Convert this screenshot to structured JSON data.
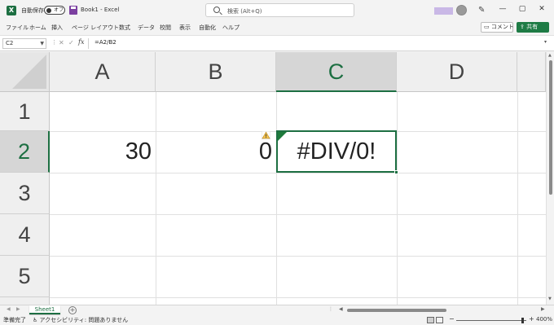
{
  "titlebar": {
    "app_icon_letter": "X",
    "autosave_label": "自動保存",
    "autosave_state": "オフ",
    "filename": "Book1 - Excel",
    "search_placeholder": "検索 (Alt+Q)",
    "window_controls": [
      "—",
      "▢",
      "✕"
    ]
  },
  "menu": {
    "items": [
      "ファイル",
      "ホーム",
      "挿入",
      "ページ レイアウト",
      "数式",
      "データ",
      "校閲",
      "表示",
      "自動化",
      "ヘルプ"
    ],
    "comment_label": "コメント",
    "share_label": "共有"
  },
  "formula_bar": {
    "name_box": "C2",
    "fx_label": "fx",
    "formula": "=A2/B2"
  },
  "grid": {
    "columns": [
      "A",
      "B",
      "C",
      "D"
    ],
    "rows": [
      "1",
      "2",
      "3",
      "4",
      "5"
    ],
    "selected_cell": "C2",
    "cells": {
      "A2": "30",
      "B2": "0",
      "C2": "#DIV/0!"
    }
  },
  "sheets": {
    "tabs": [
      "Sheet1"
    ],
    "add_label": "+"
  },
  "statusbar": {
    "ready": "準備完了",
    "accessibility": "アクセシビリティ: 問題ありません",
    "zoom": "400%"
  },
  "colors": {
    "accent": "#1d6f42",
    "error_indicator": "#1d7a3b",
    "share_button": "#1e7b45"
  },
  "icons": {
    "app": "excel-icon",
    "save": "save-icon",
    "search": "search-icon",
    "warning": "warning-icon",
    "pen": "pen-icon"
  }
}
